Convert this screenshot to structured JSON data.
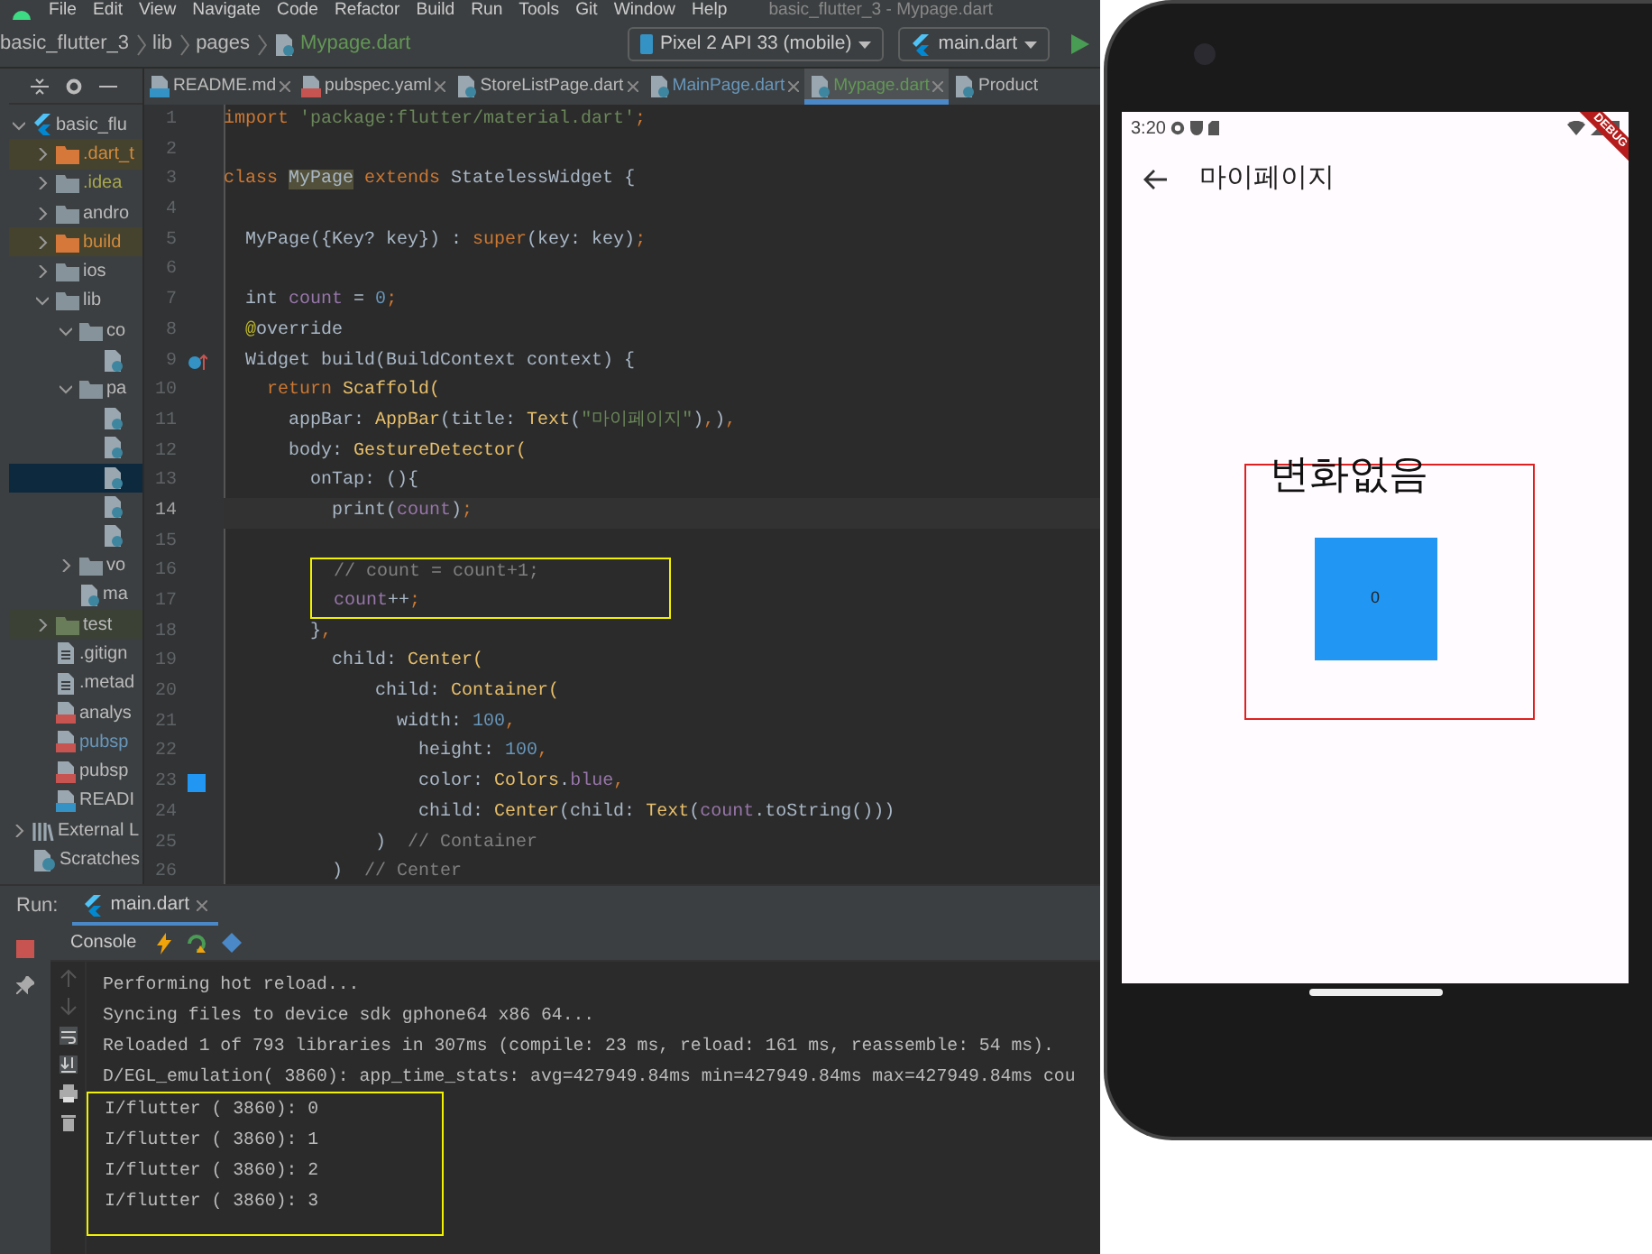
{
  "menu_bar": {
    "items": [
      "File",
      "Edit",
      "View",
      "Navigate",
      "Code",
      "Refactor",
      "Build",
      "Run",
      "Tools",
      "Git",
      "Window",
      "Help"
    ],
    "title": "basic_flutter_3 - Mypage.dart"
  },
  "toolbar": {
    "breadcrumb": [
      {
        "label": "basic_flutter_3",
        "kind": "project"
      },
      {
        "label": "lib",
        "kind": "folder"
      },
      {
        "label": "pages",
        "kind": "folder"
      },
      {
        "label": "Mypage.dart",
        "kind": "file"
      }
    ],
    "device": "Pixel 2 API 33 (mobile)",
    "run_config": "main.dart"
  },
  "project_tree": [
    {
      "label": "basic_flu",
      "kind": "flutter",
      "expanded": true,
      "selected": false,
      "children": [
        {
          "label": ".dart_t",
          "kind": "folder",
          "excluded": true,
          "expanded": false,
          "selected": false
        },
        {
          "label": ".idea",
          "kind": "folder",
          "ignored": true,
          "expanded": false,
          "selected": false
        },
        {
          "label": "andro",
          "kind": "folder",
          "expanded": false,
          "selected": false
        },
        {
          "label": "build",
          "kind": "folder",
          "excluded": true,
          "expanded": false,
          "selected": false
        },
        {
          "label": "ios",
          "kind": "folder",
          "expanded": false,
          "selected": false
        },
        {
          "label": "lib",
          "kind": "folder",
          "expanded": true,
          "selected": false,
          "children": [
            {
              "label": "co",
              "kind": "folder",
              "expanded": true,
              "selected": false,
              "children": [
                {
                  "kind": "dart",
                  "selected": false
                }
              ]
            },
            {
              "label": "pa",
              "kind": "folder",
              "expanded": true,
              "selected": false,
              "children": [
                {
                  "kind": "dart",
                  "selected": false
                },
                {
                  "kind": "dart",
                  "selected": false
                },
                {
                  "kind": "dart",
                  "selected": true
                },
                {
                  "kind": "dart",
                  "selected": false
                },
                {
                  "kind": "dart",
                  "selected": false
                }
              ]
            },
            {
              "label": "vo",
              "kind": "folder",
              "expanded": false,
              "selected": false
            },
            {
              "label": "ma",
              "kind": "dart",
              "selected": false
            }
          ]
        },
        {
          "label": "test",
          "kind": "folder",
          "test_root": true,
          "expanded": false,
          "selected": false
        },
        {
          "label": ".gitign",
          "kind": "file",
          "selected": false
        },
        {
          "label": ".metad",
          "kind": "file",
          "selected": false
        },
        {
          "label": "analys",
          "kind": "yaml",
          "selected": false
        },
        {
          "label": "pubsp",
          "kind": "yaml",
          "modified": true,
          "selected": false
        },
        {
          "label": "pubsp",
          "kind": "yaml",
          "selected": false
        },
        {
          "label": "READI",
          "kind": "md",
          "selected": false
        }
      ]
    },
    {
      "label": "External L",
      "kind": "library",
      "expanded": false,
      "selected": false
    },
    {
      "label": "Scratches",
      "kind": "scratch",
      "selected": false
    }
  ],
  "editor_tabs": [
    {
      "label": "README.md",
      "kind": "md",
      "selected": false
    },
    {
      "label": "pubspec.yaml",
      "kind": "yaml",
      "selected": false
    },
    {
      "label": "StoreListPage.dart",
      "kind": "dart",
      "selected": false
    },
    {
      "label": "MainPage.dart",
      "kind": "dart",
      "modified": true,
      "selected": false
    },
    {
      "label": "Mypage.dart",
      "kind": "dart",
      "added": true,
      "selected": true
    },
    {
      "label": "Product",
      "kind": "dart",
      "selected": false
    }
  ],
  "code_lines": [
    {
      "number": "1",
      "tokens": [
        {
          "text": "import",
          "kind": "keyword"
        },
        {
          "text": " 'package:flutter/material.dart'",
          "kind": "string"
        },
        {
          "text": ";",
          "kind": "keyword"
        }
      ]
    },
    {
      "number": "2"
    },
    {
      "number": "3",
      "tokens": [
        {
          "text": "class ",
          "kind": "keyword"
        },
        {
          "text": "MyPage",
          "kind": "match"
        },
        {
          "text": " extends",
          "kind": "keyword"
        },
        {
          "text": " StatelessWidget {",
          "kind": "plain"
        }
      ]
    },
    {
      "number": "4"
    },
    {
      "number": "5",
      "tokens": [
        {
          "text": "  MyPage({Key? key}) : ",
          "kind": "plain"
        },
        {
          "text": "super",
          "kind": "keyword"
        },
        {
          "text": "(key: key)",
          "kind": "plain"
        },
        {
          "text": ";",
          "kind": "keyword"
        }
      ]
    },
    {
      "number": "6"
    },
    {
      "number": "7",
      "tokens": [
        {
          "text": "  int ",
          "kind": "plain"
        },
        {
          "text": "count",
          "kind": "field"
        },
        {
          "text": " = ",
          "kind": "plain"
        },
        {
          "text": "0",
          "kind": "number"
        },
        {
          "text": ";",
          "kind": "keyword"
        }
      ]
    },
    {
      "number": "8",
      "tokens": [
        {
          "text": "  @",
          "kind": "annotation"
        },
        {
          "text": "override",
          "kind": "plain"
        }
      ]
    },
    {
      "number": "9",
      "overrides": true,
      "tokens": [
        {
          "text": "  Widget build(BuildContext context) {",
          "kind": "plain"
        }
      ]
    },
    {
      "number": "10",
      "tokens": [
        {
          "text": "    return",
          "kind": "keyword"
        },
        {
          "text": " Scaffold(",
          "kind": "function"
        }
      ]
    },
    {
      "number": "11",
      "tokens": [
        {
          "text": "      appBar: ",
          "kind": "plain"
        },
        {
          "text": "AppBar",
          "kind": "function"
        },
        {
          "text": "(title: ",
          "kind": "plain"
        },
        {
          "text": "Text",
          "kind": "function"
        },
        {
          "text": "(",
          "kind": "plain"
        },
        {
          "text": "\"마이페이지\"",
          "kind": "string"
        },
        {
          "text": ")",
          "kind": "plain"
        },
        {
          "text": ",",
          "kind": "keyword"
        },
        {
          "text": ")",
          "kind": "plain"
        },
        {
          "text": ",",
          "kind": "keyword"
        }
      ]
    },
    {
      "number": "12",
      "tokens": [
        {
          "text": "      body: ",
          "kind": "plain"
        },
        {
          "text": "GestureDetector(",
          "kind": "function"
        }
      ]
    },
    {
      "number": "13",
      "tokens": [
        {
          "text": "        onTap: (){",
          "kind": "plain"
        }
      ]
    },
    {
      "number": "14",
      "current": true,
      "tokens": [
        {
          "text": "          print(",
          "kind": "plain"
        },
        {
          "text": "count",
          "kind": "field"
        },
        {
          "text": ")",
          "kind": "plain"
        },
        {
          "text": ";",
          "kind": "keyword"
        }
      ]
    },
    {
      "number": "15"
    },
    {
      "number": "16",
      "highlight": true,
      "tokens": [
        {
          "text": "          // count = count+1;",
          "kind": "comment"
        }
      ]
    },
    {
      "number": "17",
      "highlight": true,
      "tokens": [
        {
          "text": "          count",
          "kind": "field"
        },
        {
          "text": "++",
          "kind": "plain"
        },
        {
          "text": ";",
          "kind": "keyword"
        }
      ]
    },
    {
      "number": "18",
      "tokens": [
        {
          "text": "        }",
          "kind": "plain"
        },
        {
          "text": ",",
          "kind": "keyword"
        }
      ]
    },
    {
      "number": "19",
      "tokens": [
        {
          "text": "          child: ",
          "kind": "plain"
        },
        {
          "text": "Center(",
          "kind": "function"
        }
      ]
    },
    {
      "number": "20",
      "tokens": [
        {
          "text": "              child: ",
          "kind": "plain"
        },
        {
          "text": "Container(",
          "kind": "function"
        }
      ]
    },
    {
      "number": "21",
      "tokens": [
        {
          "text": "                width: ",
          "kind": "plain"
        },
        {
          "text": "100",
          "kind": "number"
        },
        {
          "text": ",",
          "kind": "keyword"
        }
      ]
    },
    {
      "number": "22",
      "tokens": [
        {
          "text": "                  height: ",
          "kind": "plain"
        },
        {
          "text": "100",
          "kind": "number"
        },
        {
          "text": ",",
          "kind": "keyword"
        }
      ]
    },
    {
      "number": "23",
      "color_swatch": true,
      "tokens": [
        {
          "text": "                  color: ",
          "kind": "plain"
        },
        {
          "text": "Colors",
          "kind": "function"
        },
        {
          "text": ".",
          "kind": "plain"
        },
        {
          "text": "blue",
          "kind": "field"
        },
        {
          "text": ",",
          "kind": "keyword"
        }
      ]
    },
    {
      "number": "24",
      "tokens": [
        {
          "text": "                  child: ",
          "kind": "plain"
        },
        {
          "text": "Center",
          "kind": "function"
        },
        {
          "text": "(child: ",
          "kind": "plain"
        },
        {
          "text": "Text",
          "kind": "function"
        },
        {
          "text": "(",
          "kind": "plain"
        },
        {
          "text": "count",
          "kind": "field"
        },
        {
          "text": ".toString()))",
          "kind": "plain"
        }
      ]
    },
    {
      "number": "25",
      "tokens": [
        {
          "text": "              )  ",
          "kind": "plain"
        },
        {
          "text": "// Container",
          "kind": "comment"
        }
      ]
    },
    {
      "number": "26",
      "tokens": [
        {
          "text": "          )  ",
          "kind": "plain"
        },
        {
          "text": "// Center",
          "kind": "comment"
        }
      ]
    }
  ],
  "run_panel": {
    "label": "Run:",
    "tab": "main.dart",
    "console_tab": "Console",
    "console_lines": [
      {
        "text": "Performing hot reload...",
        "highlight": false
      },
      {
        "text": "Syncing files to device sdk gphone64 x86 64...",
        "highlight": false
      },
      {
        "text": "Reloaded 1 of 793 libraries in 307ms (compile: 23 ms, reload: 161 ms, reassemble: 54 ms).",
        "highlight": false
      },
      {
        "text": "D/EGL_emulation( 3860): app_time_stats: avg=427949.84ms min=427949.84ms max=427949.84ms cou",
        "highlight": false
      },
      {
        "text": "I/flutter ( 3860): 0",
        "highlight": true
      },
      {
        "text": "I/flutter ( 3860): 1",
        "highlight": true
      },
      {
        "text": "I/flutter ( 3860): 2",
        "highlight": true
      },
      {
        "text": "I/flutter ( 3860): 3",
        "highlight": true
      }
    ]
  },
  "phone": {
    "status_bar": {
      "time": "3:20"
    },
    "debug_banner": "DEBUG",
    "app_bar": {
      "title": "마이페이지"
    },
    "box_text": "0",
    "annotation": {
      "text": "변화없음"
    }
  }
}
